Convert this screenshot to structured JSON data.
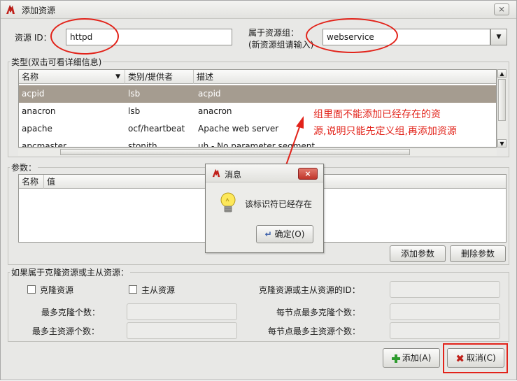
{
  "window": {
    "title": "添加资源",
    "close_glyph": "⨯"
  },
  "form": {
    "resource_id_label": "资源 ID：",
    "resource_id_value": "httpd",
    "group_label_line1": "属于资源组：",
    "group_label_line2": "(新资源组请输入)",
    "group_value": "webservice"
  },
  "types": {
    "section_title": "类型(双击可看详细信息)",
    "columns": [
      "名称",
      "类别/提供者",
      "描述"
    ],
    "rows": [
      {
        "name": "acpid",
        "class": "lsb",
        "desc": "acpid",
        "selected": true
      },
      {
        "name": "anacron",
        "class": "lsb",
        "desc": "anacron",
        "selected": false
      },
      {
        "name": "apache",
        "class": "ocf/heartbeat",
        "desc": "Apache web server",
        "selected": false
      },
      {
        "name": "apcmaster",
        "class": "stonith",
        "desc": "uh - No parameter segment",
        "selected": false
      }
    ]
  },
  "params": {
    "section_title": "参数：",
    "columns": [
      "名称",
      "值"
    ],
    "add_button": "添加参数",
    "delete_button": "删除参数"
  },
  "clone": {
    "section_title": "如果属于克隆资源或主从资源：",
    "clone_checkbox": "克隆资源",
    "master_checkbox": "主从资源",
    "clone_or_master_id": "克隆资源或主从资源的ID：",
    "max_clone": "最多克隆个数：",
    "max_master": "最多主资源个数：",
    "max_clone_per_node": "每节点最多克隆个数：",
    "max_master_per_node": "每节点最多主资源个数："
  },
  "buttons": {
    "add": "添加(A)",
    "cancel": "取消(C)"
  },
  "dialog": {
    "title": "消息",
    "message": "该标识符已经存在",
    "ok": "确定(O)"
  },
  "annotation": {
    "line1": "组里面不能添加已经存在的资",
    "line2": "源,说明只能先定义组,再添加资源",
    "color": "#e2231a"
  }
}
